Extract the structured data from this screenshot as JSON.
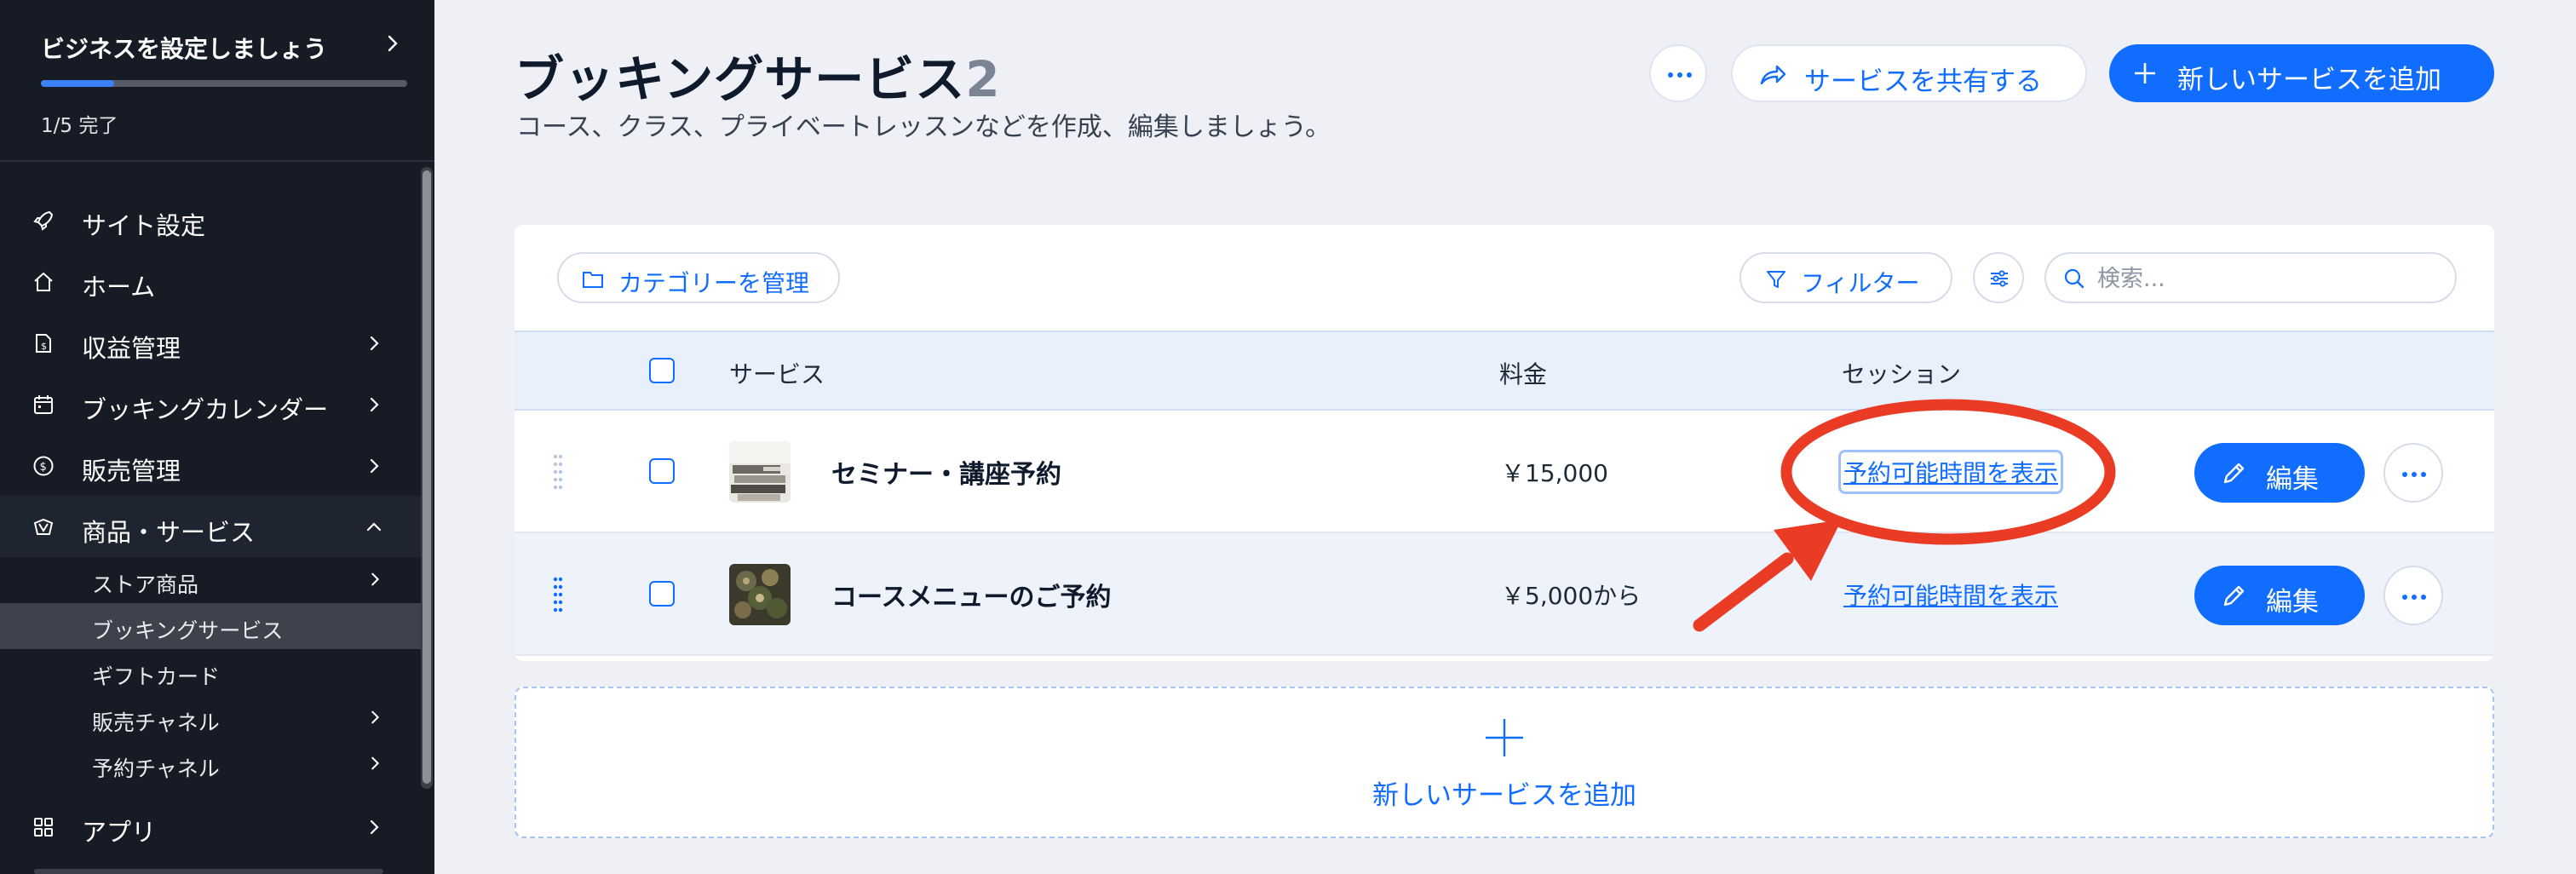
{
  "colors": {
    "sidebar_bg": "#161b26",
    "accent": "#116dff",
    "annotation": "#ea3b25"
  },
  "sidebar": {
    "setup": {
      "title": "ビジネスを設定しましょう",
      "progress": 0.2,
      "status": "1/5 完了"
    },
    "items": [
      {
        "label": "サイト設定",
        "icon": "rocket-icon",
        "has_chevron": false
      },
      {
        "label": "ホーム",
        "icon": "home-icon",
        "has_chevron": false
      },
      {
        "label": "収益管理",
        "icon": "revenue-icon",
        "has_chevron": true
      },
      {
        "label": "ブッキングカレンダー",
        "icon": "calendar-icon",
        "has_chevron": true
      },
      {
        "label": "販売管理",
        "icon": "dollar-icon",
        "has_chevron": true
      },
      {
        "label": "商品・サービス",
        "icon": "products-icon",
        "has_chevron": true,
        "expanded": true
      },
      {
        "label": "アプリ",
        "icon": "apps-icon",
        "has_chevron": true
      }
    ],
    "subitems": [
      {
        "label": "ストア商品",
        "has_chevron": true
      },
      {
        "label": "ブッキングサービス",
        "has_chevron": false,
        "active": true
      },
      {
        "label": "ギフトカード",
        "has_chevron": false
      },
      {
        "label": "販売チャネル",
        "has_chevron": true
      },
      {
        "label": "予約チャネル",
        "has_chevron": true
      }
    ]
  },
  "header": {
    "title": "ブッキングサービス",
    "count": "2",
    "subtitle": "コース、クラス、プライベートレッスンなどを作成、編集しましょう。",
    "more_icon": "more-icon",
    "share_label": "サービスを共有する",
    "add_label": "新しいサービスを追加"
  },
  "toolbar": {
    "category_label": "カテゴリーを管理",
    "filter_label": "フィルター",
    "search_placeholder": "検索...",
    "search_value": ""
  },
  "table": {
    "columns": [
      "サービス",
      "料金",
      "セッション"
    ],
    "rows": [
      {
        "name": "セミナー・講座予約",
        "price": "￥15,000",
        "session_link": "予約可能時間を表示",
        "edit_label": "編集",
        "thumb": "seminar-thumbnail"
      },
      {
        "name": "コースメニューのご予約",
        "price": "￥5,000から",
        "session_link": "予約可能時間を表示",
        "edit_label": "編集",
        "thumb": "food-thumbnail"
      }
    ]
  },
  "add_new": {
    "label": "新しいサービスを追加"
  }
}
